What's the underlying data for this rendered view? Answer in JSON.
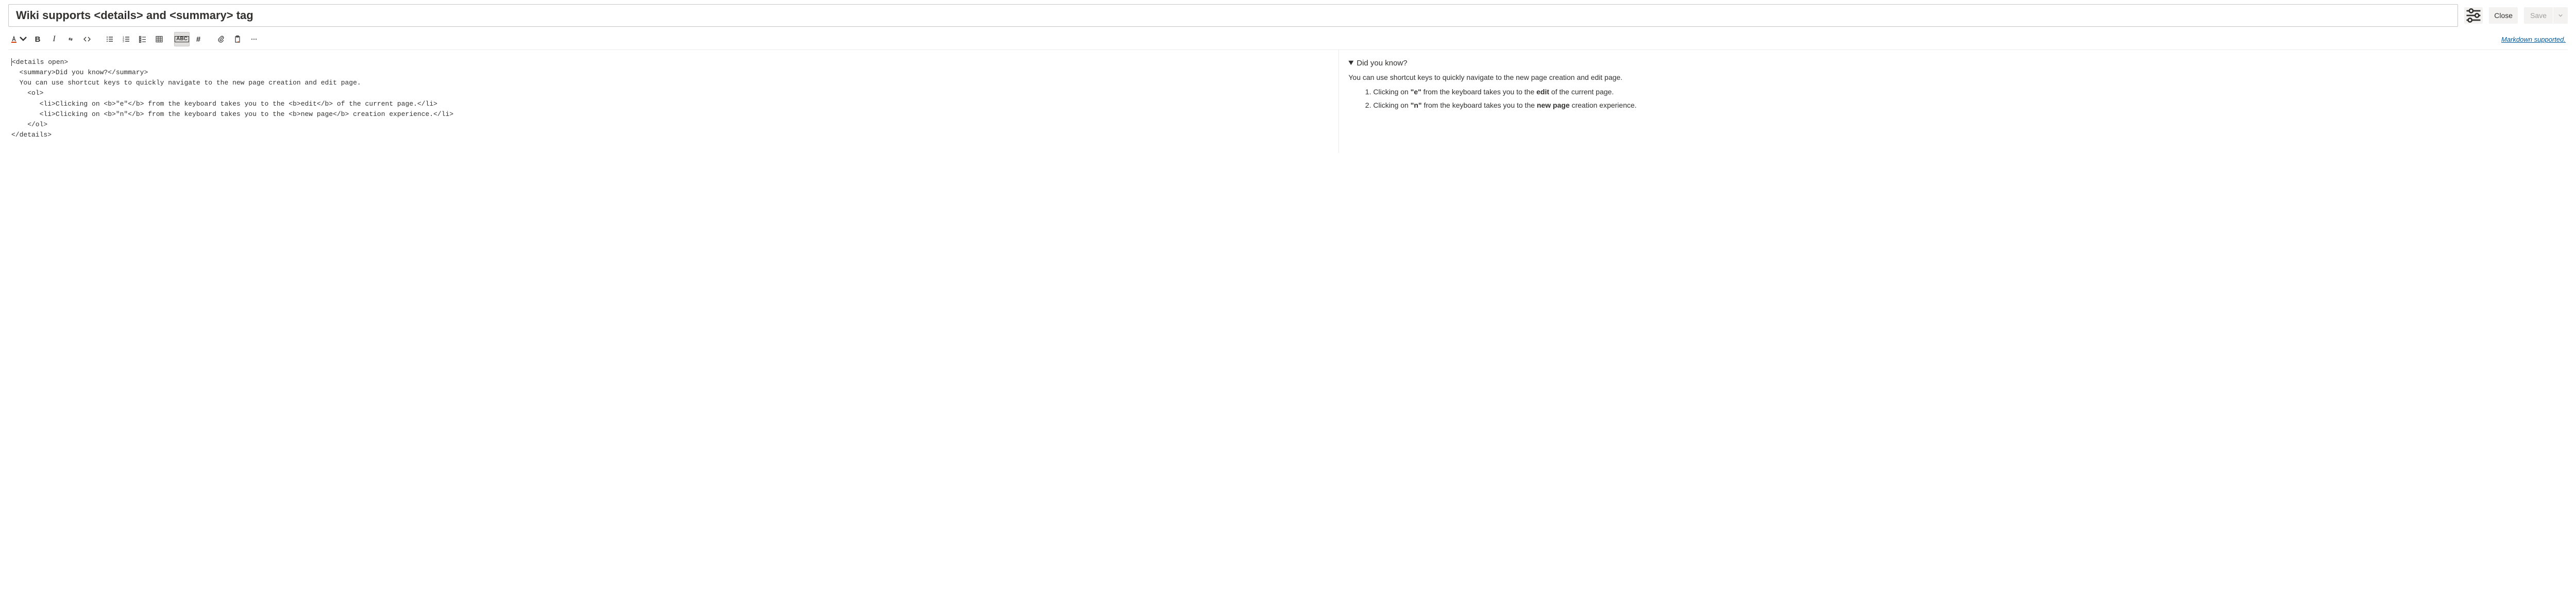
{
  "header": {
    "title_value": "Wiki supports <details> and <summary> tag",
    "close_label": "Close",
    "save_label": "Save"
  },
  "toolbar": {
    "markdown_link": "Markdown supported."
  },
  "editor": {
    "raw": "<details open>\n  <summary>Did you know?</summary>\n  You can use shortcut keys to quickly navigate to the new page creation and edit page.\n    <ol>\n       <li>Clicking on <b>\"e\"</b> from the keyboard takes you to the <b>edit</b> of the current page.</li>\n       <li>Clicking on <b>\"n\"</b> from the keyboard takes you to the <b>new page</b> creation experience.</li>\n    </ol>\n</details>"
  },
  "preview": {
    "summary": "Did you know?",
    "intro": "You can use shortcut keys to quickly navigate to the new page creation and edit page.",
    "items": [
      {
        "prefix": "Clicking on ",
        "key": "\"e\"",
        "mid": " from the keyboard takes you to the ",
        "bold": "edit",
        "suffix": " of the current page."
      },
      {
        "prefix": "Clicking on ",
        "key": "\"n\"",
        "mid": " from the keyboard takes you to the ",
        "bold": "new page",
        "suffix": " creation experience."
      }
    ]
  }
}
